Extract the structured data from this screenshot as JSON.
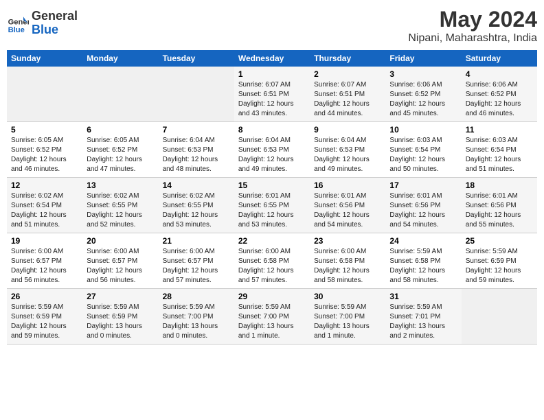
{
  "header": {
    "logo_line1": "General",
    "logo_line2": "Blue",
    "title": "May 2024",
    "subtitle": "Nipani, Maharashtra, India"
  },
  "days_of_week": [
    "Sunday",
    "Monday",
    "Tuesday",
    "Wednesday",
    "Thursday",
    "Friday",
    "Saturday"
  ],
  "weeks": [
    [
      {
        "day": "",
        "info": ""
      },
      {
        "day": "",
        "info": ""
      },
      {
        "day": "",
        "info": ""
      },
      {
        "day": "1",
        "info": "Sunrise: 6:07 AM\nSunset: 6:51 PM\nDaylight: 12 hours\nand 43 minutes."
      },
      {
        "day": "2",
        "info": "Sunrise: 6:07 AM\nSunset: 6:51 PM\nDaylight: 12 hours\nand 44 minutes."
      },
      {
        "day": "3",
        "info": "Sunrise: 6:06 AM\nSunset: 6:52 PM\nDaylight: 12 hours\nand 45 minutes."
      },
      {
        "day": "4",
        "info": "Sunrise: 6:06 AM\nSunset: 6:52 PM\nDaylight: 12 hours\nand 46 minutes."
      }
    ],
    [
      {
        "day": "5",
        "info": "Sunrise: 6:05 AM\nSunset: 6:52 PM\nDaylight: 12 hours\nand 46 minutes."
      },
      {
        "day": "6",
        "info": "Sunrise: 6:05 AM\nSunset: 6:52 PM\nDaylight: 12 hours\nand 47 minutes."
      },
      {
        "day": "7",
        "info": "Sunrise: 6:04 AM\nSunset: 6:53 PM\nDaylight: 12 hours\nand 48 minutes."
      },
      {
        "day": "8",
        "info": "Sunrise: 6:04 AM\nSunset: 6:53 PM\nDaylight: 12 hours\nand 49 minutes."
      },
      {
        "day": "9",
        "info": "Sunrise: 6:04 AM\nSunset: 6:53 PM\nDaylight: 12 hours\nand 49 minutes."
      },
      {
        "day": "10",
        "info": "Sunrise: 6:03 AM\nSunset: 6:54 PM\nDaylight: 12 hours\nand 50 minutes."
      },
      {
        "day": "11",
        "info": "Sunrise: 6:03 AM\nSunset: 6:54 PM\nDaylight: 12 hours\nand 51 minutes."
      }
    ],
    [
      {
        "day": "12",
        "info": "Sunrise: 6:02 AM\nSunset: 6:54 PM\nDaylight: 12 hours\nand 51 minutes."
      },
      {
        "day": "13",
        "info": "Sunrise: 6:02 AM\nSunset: 6:55 PM\nDaylight: 12 hours\nand 52 minutes."
      },
      {
        "day": "14",
        "info": "Sunrise: 6:02 AM\nSunset: 6:55 PM\nDaylight: 12 hours\nand 53 minutes."
      },
      {
        "day": "15",
        "info": "Sunrise: 6:01 AM\nSunset: 6:55 PM\nDaylight: 12 hours\nand 53 minutes."
      },
      {
        "day": "16",
        "info": "Sunrise: 6:01 AM\nSunset: 6:56 PM\nDaylight: 12 hours\nand 54 minutes."
      },
      {
        "day": "17",
        "info": "Sunrise: 6:01 AM\nSunset: 6:56 PM\nDaylight: 12 hours\nand 54 minutes."
      },
      {
        "day": "18",
        "info": "Sunrise: 6:01 AM\nSunset: 6:56 PM\nDaylight: 12 hours\nand 55 minutes."
      }
    ],
    [
      {
        "day": "19",
        "info": "Sunrise: 6:00 AM\nSunset: 6:57 PM\nDaylight: 12 hours\nand 56 minutes."
      },
      {
        "day": "20",
        "info": "Sunrise: 6:00 AM\nSunset: 6:57 PM\nDaylight: 12 hours\nand 56 minutes."
      },
      {
        "day": "21",
        "info": "Sunrise: 6:00 AM\nSunset: 6:57 PM\nDaylight: 12 hours\nand 57 minutes."
      },
      {
        "day": "22",
        "info": "Sunrise: 6:00 AM\nSunset: 6:58 PM\nDaylight: 12 hours\nand 57 minutes."
      },
      {
        "day": "23",
        "info": "Sunrise: 6:00 AM\nSunset: 6:58 PM\nDaylight: 12 hours\nand 58 minutes."
      },
      {
        "day": "24",
        "info": "Sunrise: 5:59 AM\nSunset: 6:58 PM\nDaylight: 12 hours\nand 58 minutes."
      },
      {
        "day": "25",
        "info": "Sunrise: 5:59 AM\nSunset: 6:59 PM\nDaylight: 12 hours\nand 59 minutes."
      }
    ],
    [
      {
        "day": "26",
        "info": "Sunrise: 5:59 AM\nSunset: 6:59 PM\nDaylight: 12 hours\nand 59 minutes."
      },
      {
        "day": "27",
        "info": "Sunrise: 5:59 AM\nSunset: 6:59 PM\nDaylight: 13 hours\nand 0 minutes."
      },
      {
        "day": "28",
        "info": "Sunrise: 5:59 AM\nSunset: 7:00 PM\nDaylight: 13 hours\nand 0 minutes."
      },
      {
        "day": "29",
        "info": "Sunrise: 5:59 AM\nSunset: 7:00 PM\nDaylight: 13 hours\nand 1 minute."
      },
      {
        "day": "30",
        "info": "Sunrise: 5:59 AM\nSunset: 7:00 PM\nDaylight: 13 hours\nand 1 minute."
      },
      {
        "day": "31",
        "info": "Sunrise: 5:59 AM\nSunset: 7:01 PM\nDaylight: 13 hours\nand 2 minutes."
      },
      {
        "day": "",
        "info": ""
      }
    ]
  ]
}
